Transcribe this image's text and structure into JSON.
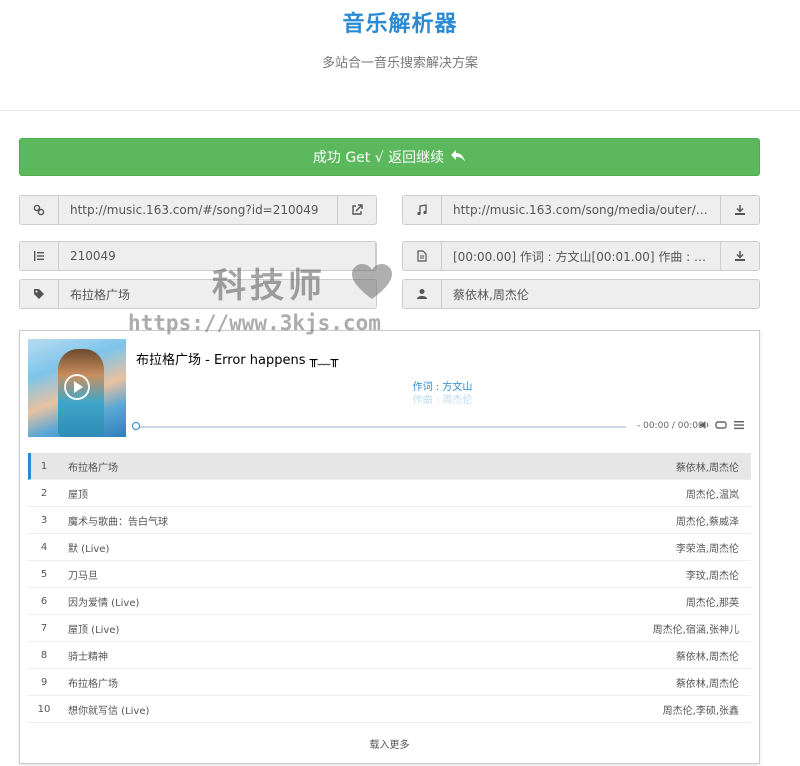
{
  "header": {
    "title": "音乐解析器",
    "subtitle": "多站合一音乐搜索解决方案"
  },
  "success_button": {
    "label": "成功 Get √ 返回继续",
    "icon": "reply-icon"
  },
  "fields": {
    "song_link": {
      "icon": "link-icon",
      "value": "http://music.163.com/#/song?id=210049",
      "action_icon": "external-link-icon"
    },
    "song_url": {
      "icon": "music-icon",
      "value": "http://music.163.com/song/media/outer/ur...",
      "action_icon": "download-icon"
    },
    "song_id": {
      "icon": "list-ordered-icon",
      "value": "210049"
    },
    "lyrics": {
      "icon": "file-text-icon",
      "value": "[00:00.00] 作词 : 方文山[00:01.00] 作曲 : 周杰...",
      "action_icon": "download-icon"
    },
    "song_name": {
      "icon": "tag-icon",
      "value": "布拉格广场"
    },
    "artist": {
      "icon": "user-icon",
      "value": "蔡依林,周杰伦"
    }
  },
  "player": {
    "now_playing_title": "布拉格广场 - Error happens ╥﹏╥",
    "lyric_current": "作词 : 方文山",
    "lyric_next": "作曲 : 周杰伦",
    "time": "- 00:00 / 00:00",
    "progress": 0,
    "playlist": [
      {
        "num": "1",
        "name": "布拉格广场",
        "singer": "蔡依林,周杰伦"
      },
      {
        "num": "2",
        "name": "屋顶",
        "singer": "周杰伦,温岚"
      },
      {
        "num": "3",
        "name": "魔术与歌曲：告白气球",
        "singer": "周杰伦,蔡威泽"
      },
      {
        "num": "4",
        "name": "默 (Live)",
        "singer": "李荣浩,周杰伦"
      },
      {
        "num": "5",
        "name": "刀马旦",
        "singer": "李玟,周杰伦"
      },
      {
        "num": "6",
        "name": "因为爱情 (Live)",
        "singer": "周杰伦,那英"
      },
      {
        "num": "7",
        "name": "屋顶 (Live)",
        "singer": "周杰伦,宿涵,张神儿"
      },
      {
        "num": "8",
        "name": "骑士精神",
        "singer": "蔡依林,周杰伦"
      },
      {
        "num": "9",
        "name": "布拉格广场",
        "singer": "蔡依林,周杰伦"
      },
      {
        "num": "10",
        "name": "想你就写信 (Live)",
        "singer": "周杰伦,李硕,张鑫"
      }
    ],
    "load_more": "载入更多"
  },
  "watermark": {
    "text": "科技师",
    "url": "https://www.3kjs.com"
  },
  "colors": {
    "accent": "#2a8ad4",
    "success": "#5cb85c"
  }
}
